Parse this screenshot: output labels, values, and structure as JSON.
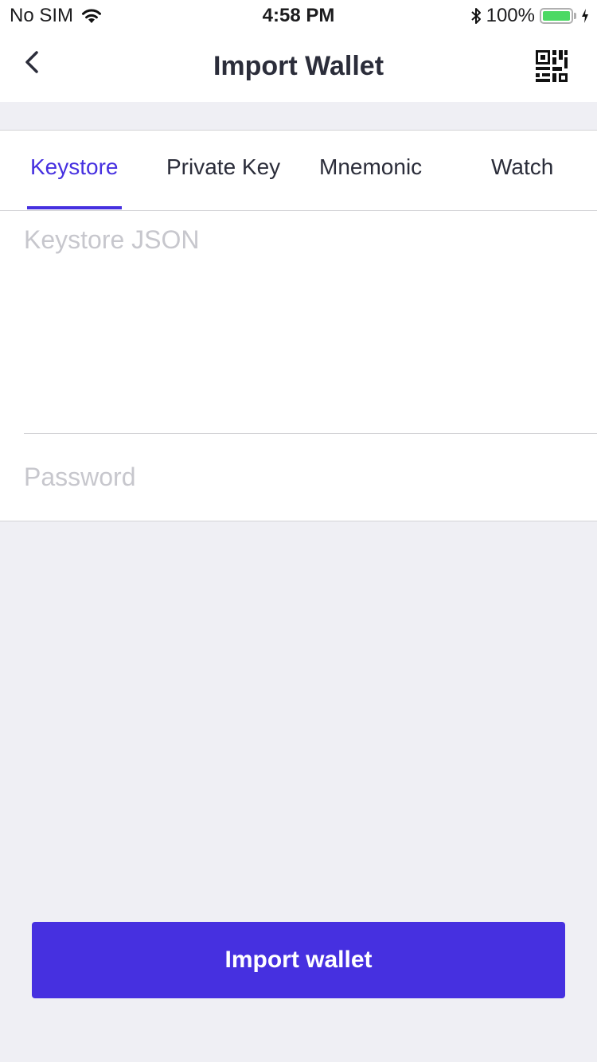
{
  "status_bar": {
    "carrier": "No SIM",
    "time": "4:58 PM",
    "battery_percent": "100%",
    "battery_level": 1.0,
    "icons": [
      "wifi-icon",
      "bluetooth-icon",
      "battery-icon",
      "charging-icon"
    ]
  },
  "nav": {
    "title": "Import Wallet",
    "back_icon": "chevron-left-icon",
    "scan_icon": "qr-code-icon"
  },
  "tabs": [
    {
      "label": "Keystore",
      "active": true
    },
    {
      "label": "Private Key",
      "active": false
    },
    {
      "label": "Mnemonic",
      "active": false
    },
    {
      "label": "Watch",
      "active": false
    }
  ],
  "form": {
    "keystore_placeholder": "Keystore JSON",
    "keystore_value": "",
    "password_placeholder": "Password",
    "password_value": ""
  },
  "actions": {
    "import_label": "Import wallet"
  },
  "colors": {
    "accent": "#4630e0",
    "background": "#efeff4",
    "battery": "#4cd964"
  }
}
